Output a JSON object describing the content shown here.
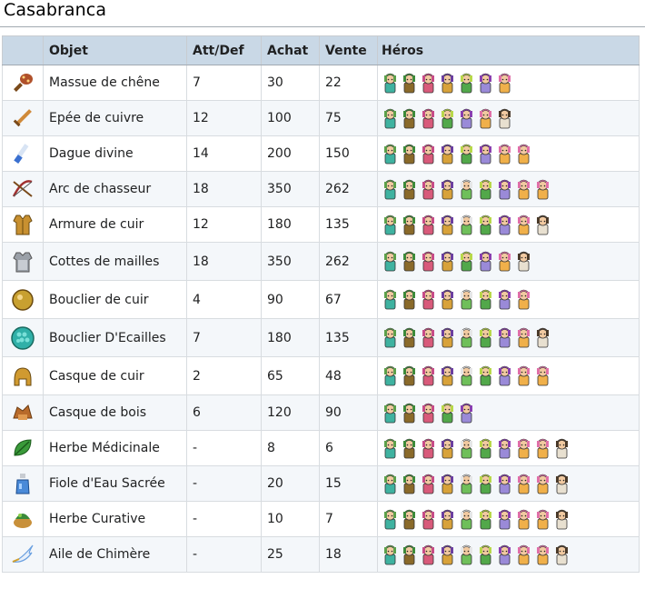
{
  "page": {
    "title": "Casabranca"
  },
  "headers": {
    "icon": "",
    "objet": "Objet",
    "att": "Att/Def",
    "achat": "Achat",
    "vente": "Vente",
    "heros": "Héros"
  },
  "hero_types": {
    "A": {
      "name": "hero-elf-green",
      "hair": "#5ca04a",
      "body": "#3fb2a0",
      "skin": "#f1c9a0"
    },
    "B": {
      "name": "hero-warrior-green",
      "hair": "#3d8a3a",
      "body": "#8a6a2a",
      "skin": "#f1c9a0"
    },
    "C": {
      "name": "hero-pink-mage",
      "hair": "#c74c88",
      "body": "#d85a7a",
      "skin": "#f1c9a0"
    },
    "D": {
      "name": "hero-purple-monk",
      "hair": "#6b3fa0",
      "body": "#d8a23a",
      "skin": "#f1c9a0"
    },
    "E": {
      "name": "hero-elder-sage",
      "hair": "#e6e6e6",
      "body": "#6fbf5a",
      "skin": "#f1c9a0"
    },
    "F": {
      "name": "hero-green-dancer",
      "hair": "#b8d84a",
      "body": "#52a84a",
      "skin": "#f1c9a0"
    },
    "G": {
      "name": "hero-purple-lady",
      "hair": "#8a3fb0",
      "body": "#9a8ad8",
      "skin": "#f1c9a0"
    },
    "H": {
      "name": "hero-pink-twin",
      "hair": "#e070a8",
      "body": "#f0b04a",
      "skin": "#f1c9a0"
    },
    "I": {
      "name": "hero-dark-nun",
      "hair": "#4a3a2a",
      "body": "#e8e0d0",
      "skin": "#f1c9a0"
    }
  },
  "rows": [
    {
      "icon": "club-icon",
      "icon_color": "#b0502a",
      "objet": "Massue de chêne",
      "att": "7",
      "achat": "30",
      "vente": "22",
      "heroes": "ABCDFGH"
    },
    {
      "icon": "sword-icon",
      "icon_color": "#d08a3a",
      "objet": "Epée de cuivre",
      "att": "12",
      "achat": "100",
      "vente": "75",
      "heroes": "ABCFGHI"
    },
    {
      "icon": "dagger-icon",
      "icon_color": "#3a70d0",
      "objet": "Dague divine",
      "att": "14",
      "achat": "200",
      "vente": "150",
      "heroes": "ABCDFGHH"
    },
    {
      "icon": "crossbow-icon",
      "icon_color": "#a03030",
      "objet": "Arc de chasseur",
      "att": "18",
      "achat": "350",
      "vente": "262",
      "heroes": "ABCDEFGHH"
    },
    {
      "icon": "leather-armor-icon",
      "icon_color": "#c89030",
      "objet": "Armure de cuir",
      "att": "12",
      "achat": "180",
      "vente": "135",
      "heroes": "ABCDEFGHI"
    },
    {
      "icon": "chainmail-icon",
      "icon_color": "#9aa0a8",
      "objet": "Cottes de mailles",
      "att": "18",
      "achat": "350",
      "vente": "262",
      "heroes": "ABCDFGHI"
    },
    {
      "icon": "leather-shield-icon",
      "icon_color": "#c8a030",
      "objet": "Bouclier de cuir",
      "att": "4",
      "achat": "90",
      "vente": "67",
      "heroes": "ABCDEFGH"
    },
    {
      "icon": "scale-shield-icon",
      "icon_color": "#30b0a8",
      "objet": "Bouclier D'Ecailles",
      "att": "7",
      "achat": "180",
      "vente": "135",
      "heroes": "ABCDEFGHI"
    },
    {
      "icon": "leather-helmet-icon",
      "icon_color": "#d09a30",
      "objet": "Casque de cuir",
      "att": "2",
      "achat": "65",
      "vente": "48",
      "heroes": "ABCDEFGHH"
    },
    {
      "icon": "wood-helmet-icon",
      "icon_color": "#b86a2a",
      "objet": "Casque de bois",
      "att": "6",
      "achat": "120",
      "vente": "90",
      "heroes": "ABCFG"
    },
    {
      "icon": "herb-icon",
      "icon_color": "#3a9a3a",
      "objet": "Herbe Médicinale",
      "att": "-",
      "achat": "8",
      "vente": "6",
      "heroes": "ABCDEFGHHI"
    },
    {
      "icon": "holy-water-icon",
      "icon_color": "#4a8ad8",
      "objet": "Fiole d'Eau Sacrée",
      "att": "-",
      "achat": "20",
      "vente": "15",
      "heroes": "ABCDEFGHHI"
    },
    {
      "icon": "curative-herb-icon",
      "icon_color": "#3a8a3a",
      "objet": "Herbe Curative",
      "att": "-",
      "achat": "10",
      "vente": "7",
      "heroes": "ABCDEFGHHI"
    },
    {
      "icon": "chimera-wing-icon",
      "icon_color": "#6aa0e0",
      "objet": "Aile de Chimère",
      "att": "-",
      "achat": "25",
      "vente": "18",
      "heroes": "ABCDEFGHHI"
    }
  ]
}
